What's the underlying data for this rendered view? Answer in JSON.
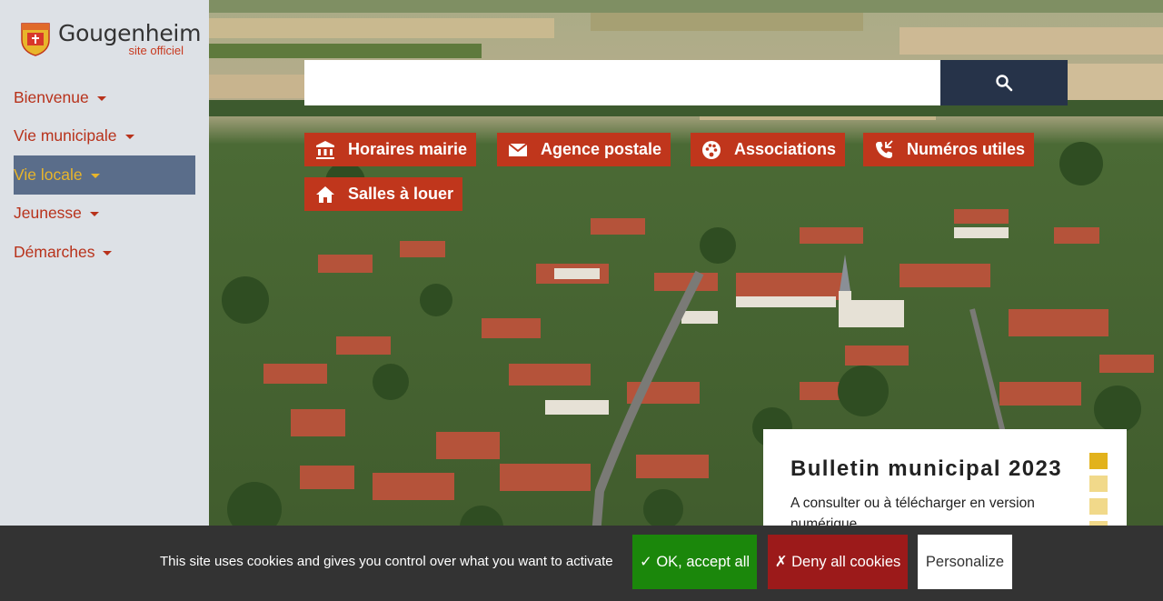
{
  "logo": {
    "name": "Gougenheim",
    "subtitle": "site officiel"
  },
  "nav": [
    {
      "label": "Bienvenue"
    },
    {
      "label": "Vie municipale"
    },
    {
      "label": "Vie locale"
    },
    {
      "label": "Jeunesse"
    },
    {
      "label": "Démarches"
    }
  ],
  "search": {
    "placeholder": "",
    "icon": "search-icon"
  },
  "quick_links": [
    {
      "label": "Horaires mairie",
      "icon": "bank-icon"
    },
    {
      "label": "Agence postale",
      "icon": "mail-icon"
    },
    {
      "label": "Associations",
      "icon": "palette-icon"
    },
    {
      "label": "Numéros utiles",
      "icon": "phone-icon"
    },
    {
      "label": "Salles à louer",
      "icon": "home-icon"
    }
  ],
  "bulletin": {
    "title": "Bulletin municipal 2023",
    "text": "A consulter ou à télécharger en version numérique"
  },
  "cookie": {
    "text": "This site uses cookies and gives you control over what you want to activate",
    "accept": "✓ OK, accept all",
    "deny": "✗ Deny all cookies",
    "personalize": "Personalize"
  },
  "colors": {
    "accent_red": "#c0361c",
    "nav_active_bg": "#5a6d8a",
    "nav_active_text": "#e8b52b",
    "search_button": "#263349",
    "accept_green": "#1b870b",
    "deny_red": "#9c1a1a"
  }
}
